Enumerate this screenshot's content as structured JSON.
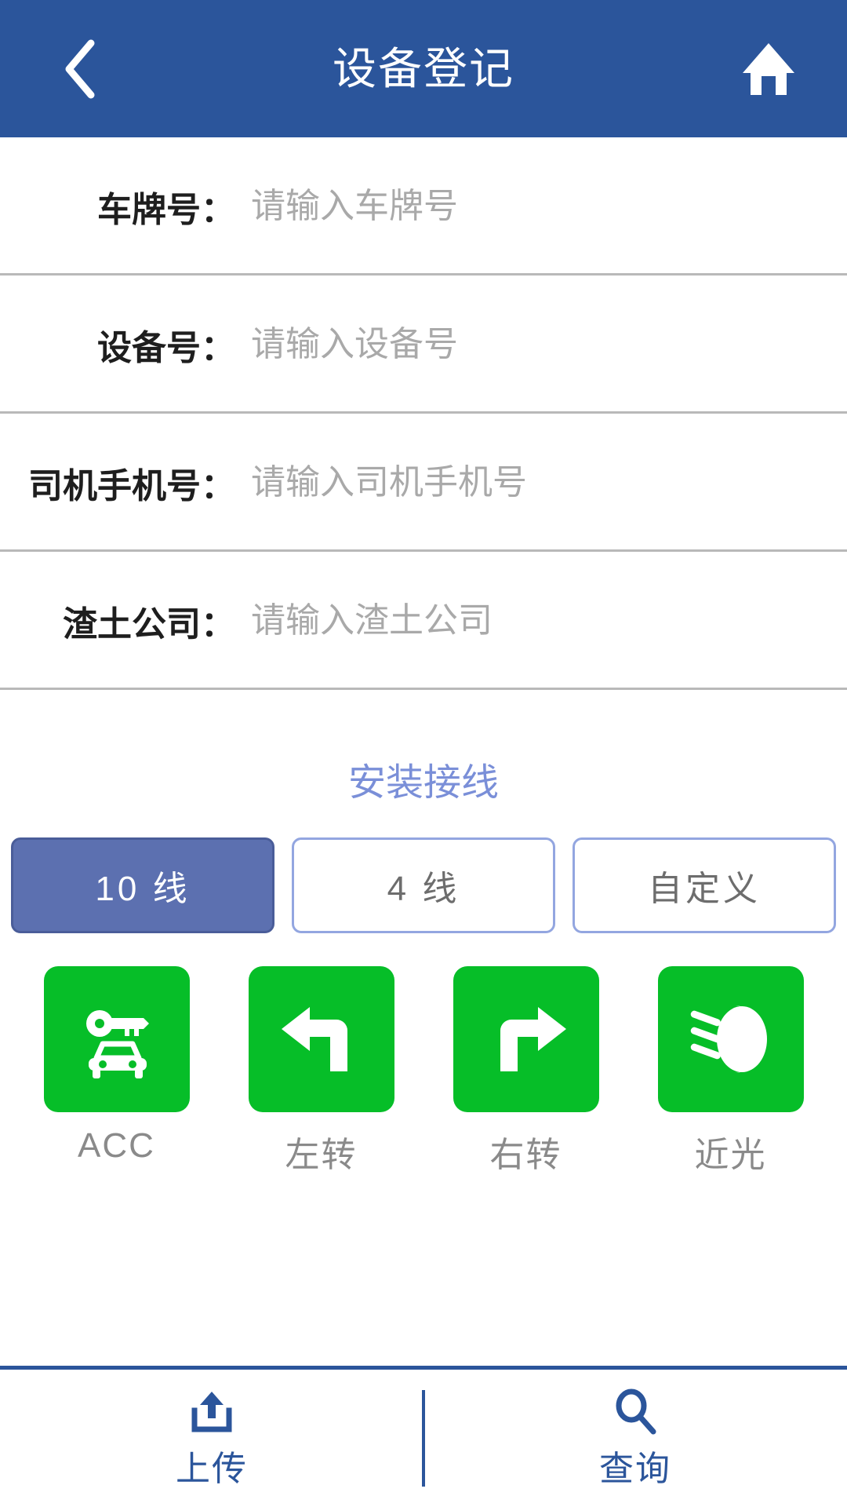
{
  "header": {
    "title": "设备登记",
    "back_icon": "chevron-left-icon",
    "home_icon": "home-icon"
  },
  "form": {
    "fields": [
      {
        "label": "车牌号：",
        "value": "",
        "placeholder": "请输入车牌号"
      },
      {
        "label": "设备号：",
        "value": "",
        "placeholder": "请输入设备号"
      },
      {
        "label": "司机手机号：",
        "value": "",
        "placeholder": "请输入司机手机号"
      },
      {
        "label": "渣土公司：",
        "value": "",
        "placeholder": "请输入渣土公司"
      }
    ]
  },
  "wiring": {
    "title": "安装接线",
    "title_color": "#7a8fd8",
    "selected_index": 0,
    "selected_bg": "#5c70b0",
    "options": [
      {
        "label": "10 线",
        "selected": true
      },
      {
        "label": "4 线",
        "selected": false
      },
      {
        "label": "自定义",
        "selected": false
      }
    ]
  },
  "status_tiles": {
    "tile_color": "#06be28",
    "items": [
      {
        "label": "ACC",
        "icon": "car-key-icon"
      },
      {
        "label": "左转",
        "icon": "turn-left-arrow-icon"
      },
      {
        "label": "右转",
        "icon": "turn-right-arrow-icon"
      },
      {
        "label": "近光",
        "icon": "low-beam-headlight-icon"
      }
    ]
  },
  "bottom_bar": {
    "accent_color": "#2b559b",
    "items": [
      {
        "label": "上传",
        "icon": "upload-icon"
      },
      {
        "label": "查询",
        "icon": "search-icon"
      }
    ]
  }
}
